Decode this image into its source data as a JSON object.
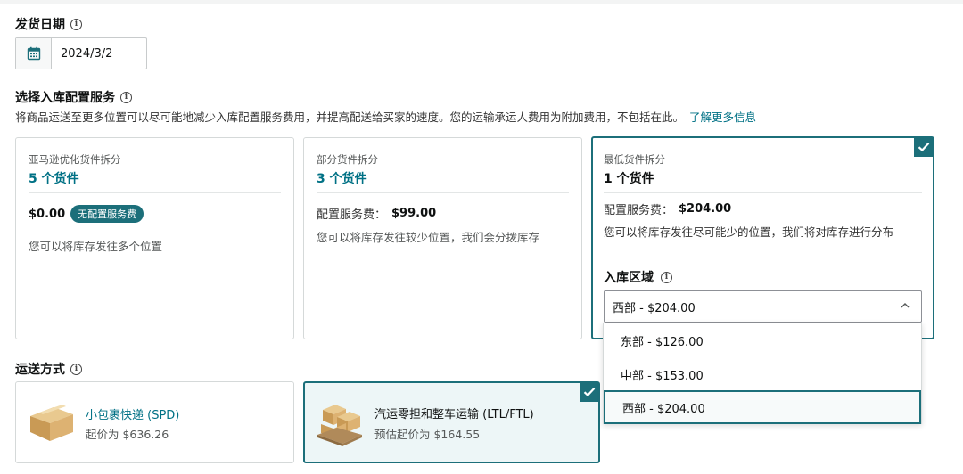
{
  "ship_date": {
    "title": "发货日期",
    "value": "2024/3/2",
    "icon": "calendar-icon"
  },
  "placement": {
    "title": "选择入库配置服务",
    "description": "将商品运送至更多位置可以尽可能地减少入库配置服务费用，并提高配送给买家的速度。您的运输承运人费用为附加费用，不包括在此。",
    "learn_more": "了解更多信息",
    "options": [
      {
        "subtitle": "亚马逊优化货件拆分",
        "title": "5 个货件",
        "fee": "$0.00",
        "badge": "无配置服务费",
        "desc": "您可以将库存发往多个位置",
        "selected": false
      },
      {
        "subtitle": "部分货件拆分",
        "title": "3 个货件",
        "fee_label": "配置服务费：",
        "fee": "$99.00",
        "desc": "您可以将库存发往较少位置，我们会分拨库存",
        "selected": false
      },
      {
        "subtitle": "最低货件拆分",
        "title": "1 个货件",
        "fee_label": "配置服务费：",
        "fee": "$204.00",
        "desc": "您可以将库存发往尽可能少的位置，我们将对库存进行分布",
        "region_label": "入库区域",
        "region_value": "西部 - $204.00",
        "selected": true
      }
    ],
    "region_options": [
      "东部 - $126.00",
      "中部 - $153.00",
      "西部 - $204.00"
    ],
    "region_selected_index": 2
  },
  "shipping": {
    "title": "运送方式",
    "options": [
      {
        "name": "小包裹快递 (SPD)",
        "price": "起价为 $636.26",
        "selected": false,
        "icon": "box-icon"
      },
      {
        "name": "汽运零担和整车运输 (LTL/FTL)",
        "price": "预估起价为 $164.55",
        "selected": true,
        "icon": "pallet-icon"
      }
    ]
  },
  "colors": {
    "accent": "#1c6f7a",
    "link": "#007185"
  }
}
